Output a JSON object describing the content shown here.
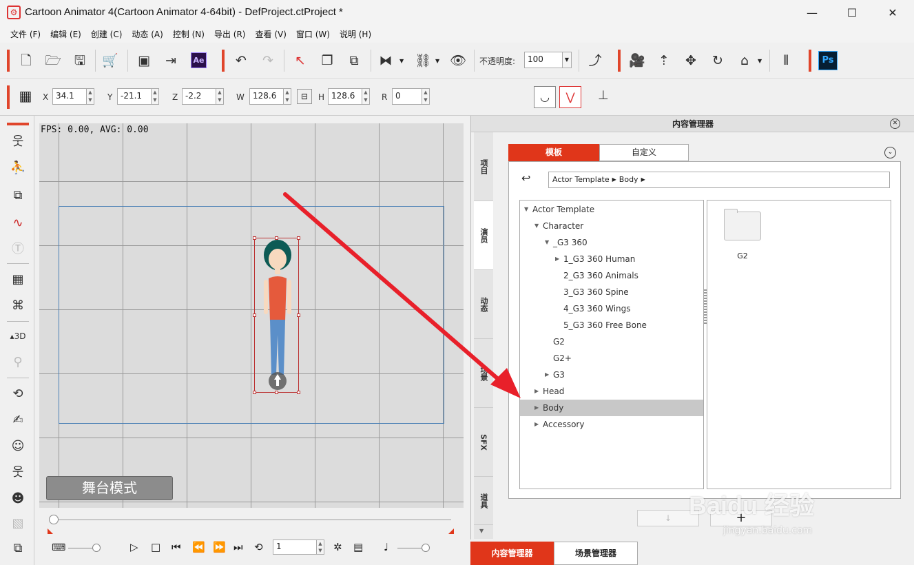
{
  "window": {
    "title": "Cartoon Animator 4(Cartoon Animator 4-64bit) - DefProject.ctProject *",
    "minimize": "—",
    "maximize": "☐",
    "close": "✕"
  },
  "menu": [
    "文件 (F)",
    "编辑 (E)",
    "创建 (C)",
    "动态 (A)",
    "控制 (N)",
    "导出 (R)",
    "查看 (V)",
    "窗口 (W)",
    "说明 (H)"
  ],
  "toolbar": {
    "opacity_label": "不透明度:",
    "opacity_value": "100",
    "ae_label": "Ae",
    "ps_label": "Ps"
  },
  "transform": {
    "x_label": "X",
    "x": "34.1",
    "y_label": "Y",
    "y": "-21.1",
    "z_label": "Z",
    "z": "-2.2",
    "w_label": "W",
    "w": "128.6",
    "h_label": "H",
    "h": "128.6",
    "r_label": "R",
    "r": "0"
  },
  "stage": {
    "fps": "FPS: 0.00, AVG: 0.00",
    "mode_button": "舞台模式"
  },
  "timeline": {
    "frame": "1"
  },
  "content_manager": {
    "title": "内容管理器",
    "side_tabs": [
      "项目",
      "演员",
      "动态",
      "场景",
      "SFX",
      "道具"
    ],
    "active_side_tab": "演员",
    "tabs": {
      "template": "模板",
      "custom": "自定义"
    },
    "breadcrumb": [
      "Actor Template",
      "Body"
    ],
    "tree": [
      {
        "label": "Actor Template",
        "indent": 0,
        "arrow": "▼"
      },
      {
        "label": "Character",
        "indent": 1,
        "arrow": "▼"
      },
      {
        "label": "_G3 360",
        "indent": 2,
        "arrow": "▼"
      },
      {
        "label": "1_G3 360 Human",
        "indent": 3,
        "arrow": "▶"
      },
      {
        "label": "2_G3 360 Animals",
        "indent": 3,
        "arrow": ""
      },
      {
        "label": "3_G3 360 Spine",
        "indent": 3,
        "arrow": ""
      },
      {
        "label": "4_G3 360 Wings",
        "indent": 3,
        "arrow": ""
      },
      {
        "label": "5_G3 360 Free Bone",
        "indent": 3,
        "arrow": ""
      },
      {
        "label": "G2",
        "indent": 2,
        "arrow": ""
      },
      {
        "label": "G2+",
        "indent": 2,
        "arrow": ""
      },
      {
        "label": "G3",
        "indent": 2,
        "arrow": "▶"
      },
      {
        "label": "Head",
        "indent": 1,
        "arrow": "▶"
      },
      {
        "label": "Body",
        "indent": 1,
        "arrow": "▶",
        "selected": true
      },
      {
        "label": "Accessory",
        "indent": 1,
        "arrow": "▶"
      }
    ],
    "preview_items": [
      {
        "label": "G2"
      }
    ]
  },
  "bottom_tabs": {
    "content_manager": "内容管理器",
    "scene_manager": "场景管理器"
  },
  "watermark": {
    "brand": "Baidu 经验",
    "url": "jingyan.baidu.com"
  },
  "colors": {
    "accent": "#e0361a",
    "arrow": "#e8202a"
  }
}
